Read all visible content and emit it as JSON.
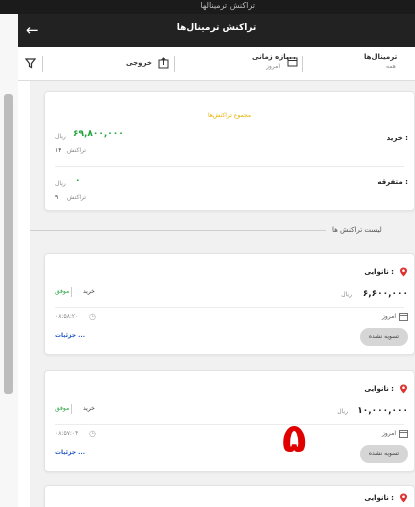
{
  "status_title": "تراکنش ترمینالها",
  "header": {
    "title": "تراکنش ترمینال‌ها"
  },
  "filters": {
    "terminals_label": "ترمینال‌ها",
    "terminals_value": "همه",
    "period_label": "بازه زمانی",
    "period_value": "امروز",
    "export_label": "خروجی"
  },
  "summary": {
    "heading": "مجموع تراکنش‌ها",
    "purchase_label": "خرید :",
    "purchase_amount": "۶۹,۸۰۰,۰۰۰",
    "purchase_unit": "ریال",
    "purchase_count": "۱۴",
    "purchase_count_label": "تراکنش",
    "misc_label": "متفرقه :",
    "misc_amount": "۰",
    "misc_unit": "ریال",
    "misc_count": "۹",
    "misc_count_label": "تراکنش"
  },
  "list_title": "لیست تراکنش ها",
  "transactions": [
    {
      "merchant": "نانوایی :",
      "amount": "۶,۶۰۰,۰۰۰",
      "unit": "ریال",
      "type": "خرید",
      "status": "موفق",
      "date": "امروز",
      "time": "۰۸:۵۸:۲۰",
      "details": "جزئیات ...",
      "settle": "تسویه نشده"
    },
    {
      "merchant": "نانوایی :",
      "amount": "۱۰,۰۰۰,۰۰۰",
      "unit": "ریال",
      "type": "خرید",
      "status": "موفق",
      "date": "امروز",
      "time": "۰۸:۵۷:۰۴",
      "details": "جزئیات ...",
      "settle": "تسویه نشده"
    },
    {
      "merchant": "نانوایی :"
    }
  ],
  "annotation": "۵",
  "colors": {
    "accent_green": "#22a33c",
    "summary_yellow": "#e4b100",
    "link_blue": "#1e55c8",
    "annotation_red": "#e00000"
  }
}
